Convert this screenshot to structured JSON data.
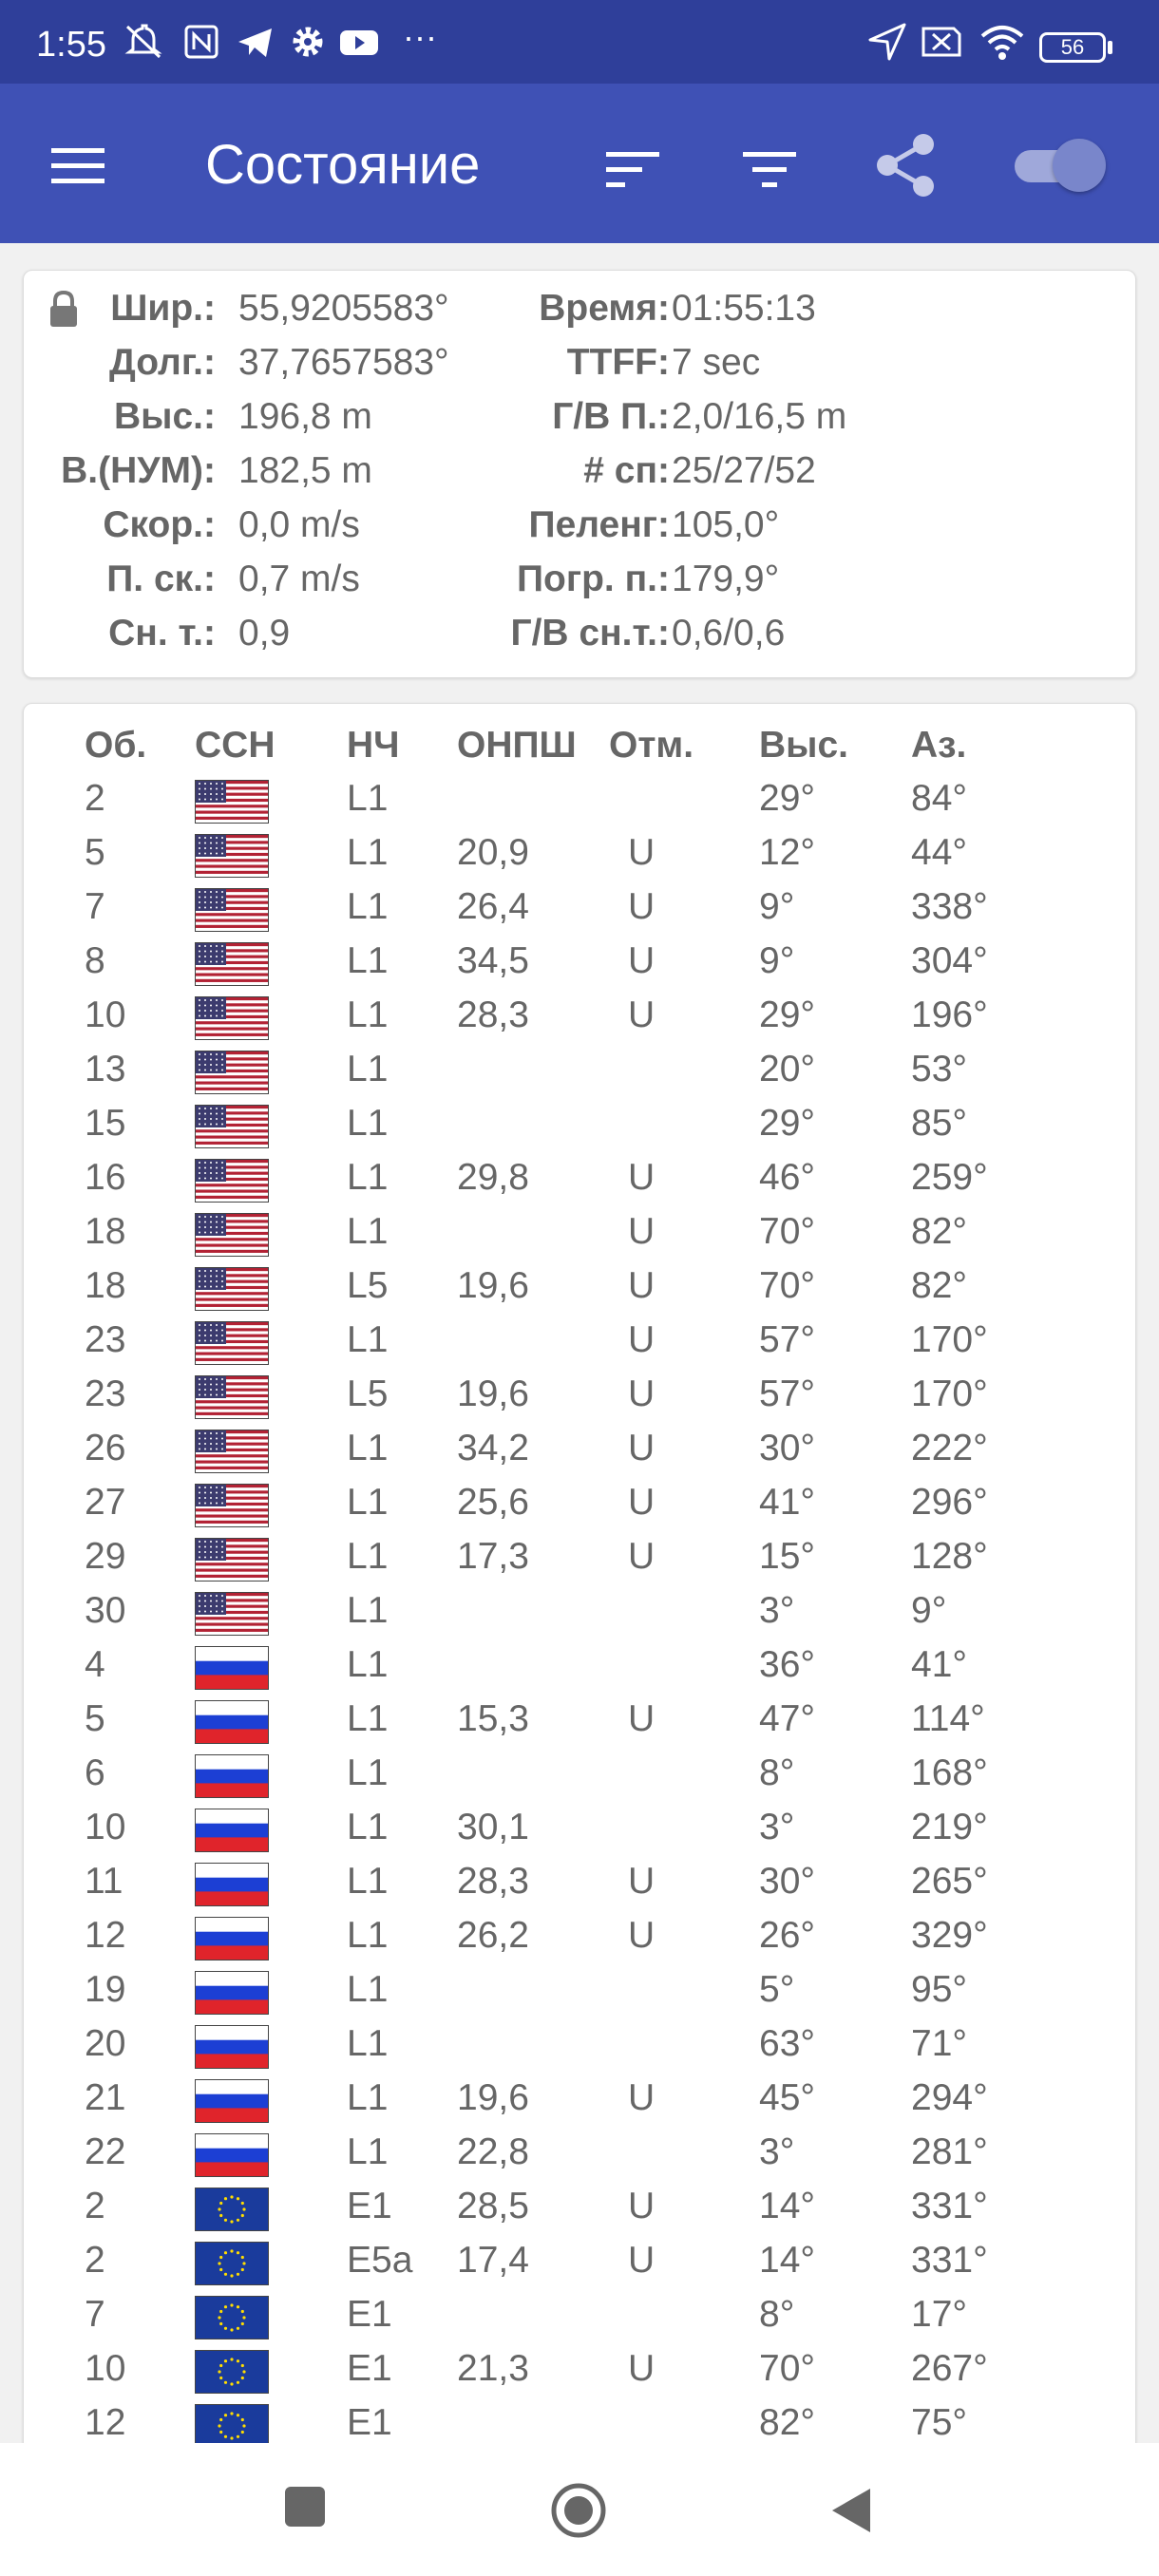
{
  "status_bar": {
    "time": "1:55",
    "icons": [
      "do-not-disturb-icon",
      "nfc-icon",
      "telegram-icon",
      "settings-icon",
      "youtube-icon",
      "more-icon",
      "location-arrow-icon",
      "sim-off-icon",
      "wifi-icon",
      "battery-icon"
    ],
    "more": "···",
    "battery": "56"
  },
  "app_bar": {
    "title": "Состояние",
    "icons": [
      "menu-icon",
      "sort-icon",
      "filter-icon",
      "share-icon",
      "toggle-switch"
    ],
    "accent": "#3f51b5"
  },
  "info": {
    "lock_icon": "lock-icon",
    "left": [
      {
        "label": "Шир.:",
        "value": "55,9205583°"
      },
      {
        "label": "Долг.:",
        "value": "37,7657583°"
      },
      {
        "label": "Выс.:",
        "value": "196,8 m"
      },
      {
        "label": "В.(НУМ):",
        "value": "182,5 m"
      },
      {
        "label": "Скор.:",
        "value": "0,0 m/s"
      },
      {
        "label": "П. ск.:",
        "value": "0,7 m/s"
      },
      {
        "label": "Сн. т.:",
        "value": "0,9"
      }
    ],
    "right": [
      {
        "label": "Время:",
        "value": "01:55:13"
      },
      {
        "label": "TTFF:",
        "value": "7 sec"
      },
      {
        "label": "Г/В П.:",
        "value": "2,0/16,5 m"
      },
      {
        "label": "# сп:",
        "value": "25/27/52"
      },
      {
        "label": "Пеленг:",
        "value": "105,0°"
      },
      {
        "label": "Погр. п.:",
        "value": "179,9°"
      },
      {
        "label": "Г/В сн.т.:",
        "value": "0,6/0,6"
      }
    ]
  },
  "table": {
    "headers": [
      "Об.",
      "ССН",
      "НЧ",
      "ОНПШ",
      "Отм.",
      "Выс.",
      "Аз."
    ],
    "rows": [
      {
        "id": "2",
        "flag": "us",
        "band": "L1",
        "cn0": "",
        "used": "",
        "elev": "29°",
        "az": "84°"
      },
      {
        "id": "5",
        "flag": "us",
        "band": "L1",
        "cn0": "20,9",
        "used": "U",
        "elev": "12°",
        "az": "44°"
      },
      {
        "id": "7",
        "flag": "us",
        "band": "L1",
        "cn0": "26,4",
        "used": "U",
        "elev": "9°",
        "az": "338°"
      },
      {
        "id": "8",
        "flag": "us",
        "band": "L1",
        "cn0": "34,5",
        "used": "U",
        "elev": "9°",
        "az": "304°"
      },
      {
        "id": "10",
        "flag": "us",
        "band": "L1",
        "cn0": "28,3",
        "used": "U",
        "elev": "29°",
        "az": "196°"
      },
      {
        "id": "13",
        "flag": "us",
        "band": "L1",
        "cn0": "",
        "used": "",
        "elev": "20°",
        "az": "53°"
      },
      {
        "id": "15",
        "flag": "us",
        "band": "L1",
        "cn0": "",
        "used": "",
        "elev": "29°",
        "az": "85°"
      },
      {
        "id": "16",
        "flag": "us",
        "band": "L1",
        "cn0": "29,8",
        "used": "U",
        "elev": "46°",
        "az": "259°"
      },
      {
        "id": "18",
        "flag": "us",
        "band": "L1",
        "cn0": "",
        "used": "U",
        "elev": "70°",
        "az": "82°"
      },
      {
        "id": "18",
        "flag": "us",
        "band": "L5",
        "cn0": "19,6",
        "used": "U",
        "elev": "70°",
        "az": "82°"
      },
      {
        "id": "23",
        "flag": "us",
        "band": "L1",
        "cn0": "",
        "used": "U",
        "elev": "57°",
        "az": "170°"
      },
      {
        "id": "23",
        "flag": "us",
        "band": "L5",
        "cn0": "19,6",
        "used": "U",
        "elev": "57°",
        "az": "170°"
      },
      {
        "id": "26",
        "flag": "us",
        "band": "L1",
        "cn0": "34,2",
        "used": "U",
        "elev": "30°",
        "az": "222°"
      },
      {
        "id": "27",
        "flag": "us",
        "band": "L1",
        "cn0": "25,6",
        "used": "U",
        "elev": "41°",
        "az": "296°"
      },
      {
        "id": "29",
        "flag": "us",
        "band": "L1",
        "cn0": "17,3",
        "used": "U",
        "elev": "15°",
        "az": "128°"
      },
      {
        "id": "30",
        "flag": "us",
        "band": "L1",
        "cn0": "",
        "used": "",
        "elev": "3°",
        "az": "9°"
      },
      {
        "id": "4",
        "flag": "ru",
        "band": "L1",
        "cn0": "",
        "used": "",
        "elev": "36°",
        "az": "41°"
      },
      {
        "id": "5",
        "flag": "ru",
        "band": "L1",
        "cn0": "15,3",
        "used": "U",
        "elev": "47°",
        "az": "114°"
      },
      {
        "id": "6",
        "flag": "ru",
        "band": "L1",
        "cn0": "",
        "used": "",
        "elev": "8°",
        "az": "168°"
      },
      {
        "id": "10",
        "flag": "ru",
        "band": "L1",
        "cn0": "30,1",
        "used": "",
        "elev": "3°",
        "az": "219°"
      },
      {
        "id": "11",
        "flag": "ru",
        "band": "L1",
        "cn0": "28,3",
        "used": "U",
        "elev": "30°",
        "az": "265°"
      },
      {
        "id": "12",
        "flag": "ru",
        "band": "L1",
        "cn0": "26,2",
        "used": "U",
        "elev": "26°",
        "az": "329°"
      },
      {
        "id": "19",
        "flag": "ru",
        "band": "L1",
        "cn0": "",
        "used": "",
        "elev": "5°",
        "az": "95°"
      },
      {
        "id": "20",
        "flag": "ru",
        "band": "L1",
        "cn0": "",
        "used": "",
        "elev": "63°",
        "az": "71°"
      },
      {
        "id": "21",
        "flag": "ru",
        "band": "L1",
        "cn0": "19,6",
        "used": "U",
        "elev": "45°",
        "az": "294°"
      },
      {
        "id": "22",
        "flag": "ru",
        "band": "L1",
        "cn0": "22,8",
        "used": "",
        "elev": "3°",
        "az": "281°"
      },
      {
        "id": "2",
        "flag": "eu",
        "band": "E1",
        "cn0": "28,5",
        "used": "U",
        "elev": "14°",
        "az": "331°"
      },
      {
        "id": "2",
        "flag": "eu",
        "band": "E5a",
        "cn0": "17,4",
        "used": "U",
        "elev": "14°",
        "az": "331°"
      },
      {
        "id": "7",
        "flag": "eu",
        "band": "E1",
        "cn0": "",
        "used": "",
        "elev": "8°",
        "az": "17°"
      },
      {
        "id": "10",
        "flag": "eu",
        "band": "E1",
        "cn0": "21,3",
        "used": "U",
        "elev": "70°",
        "az": "267°"
      },
      {
        "id": "12",
        "flag": "eu",
        "band": "E1",
        "cn0": "",
        "used": "",
        "elev": "82°",
        "az": "75°"
      }
    ]
  },
  "nav_bar": {
    "icons": [
      "recents-icon",
      "home-icon",
      "back-icon"
    ]
  }
}
